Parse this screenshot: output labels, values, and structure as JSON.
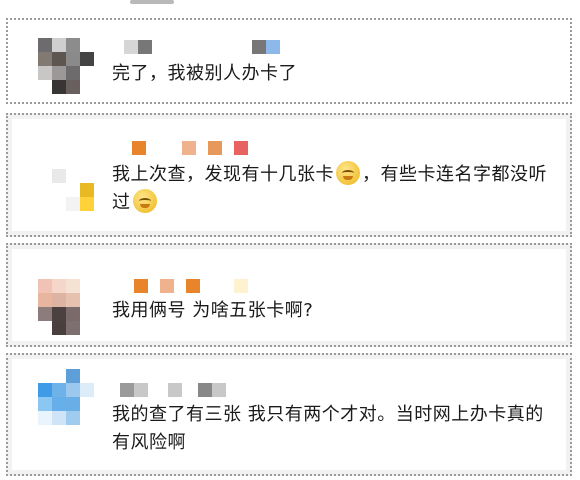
{
  "comments": [
    {
      "text": "完了，我被别人办卡了"
    },
    {
      "text": "我上次查，发现有十几张卡",
      "text_after_emoji": "，有些卡连名字都没听过",
      "emoji": "smile-face-emoji"
    },
    {
      "text": "我用俩号 为啥五张卡啊?"
    },
    {
      "text": "我的查了有三张 我只有两个才对。当时网上办卡真的有风险啊"
    }
  ]
}
